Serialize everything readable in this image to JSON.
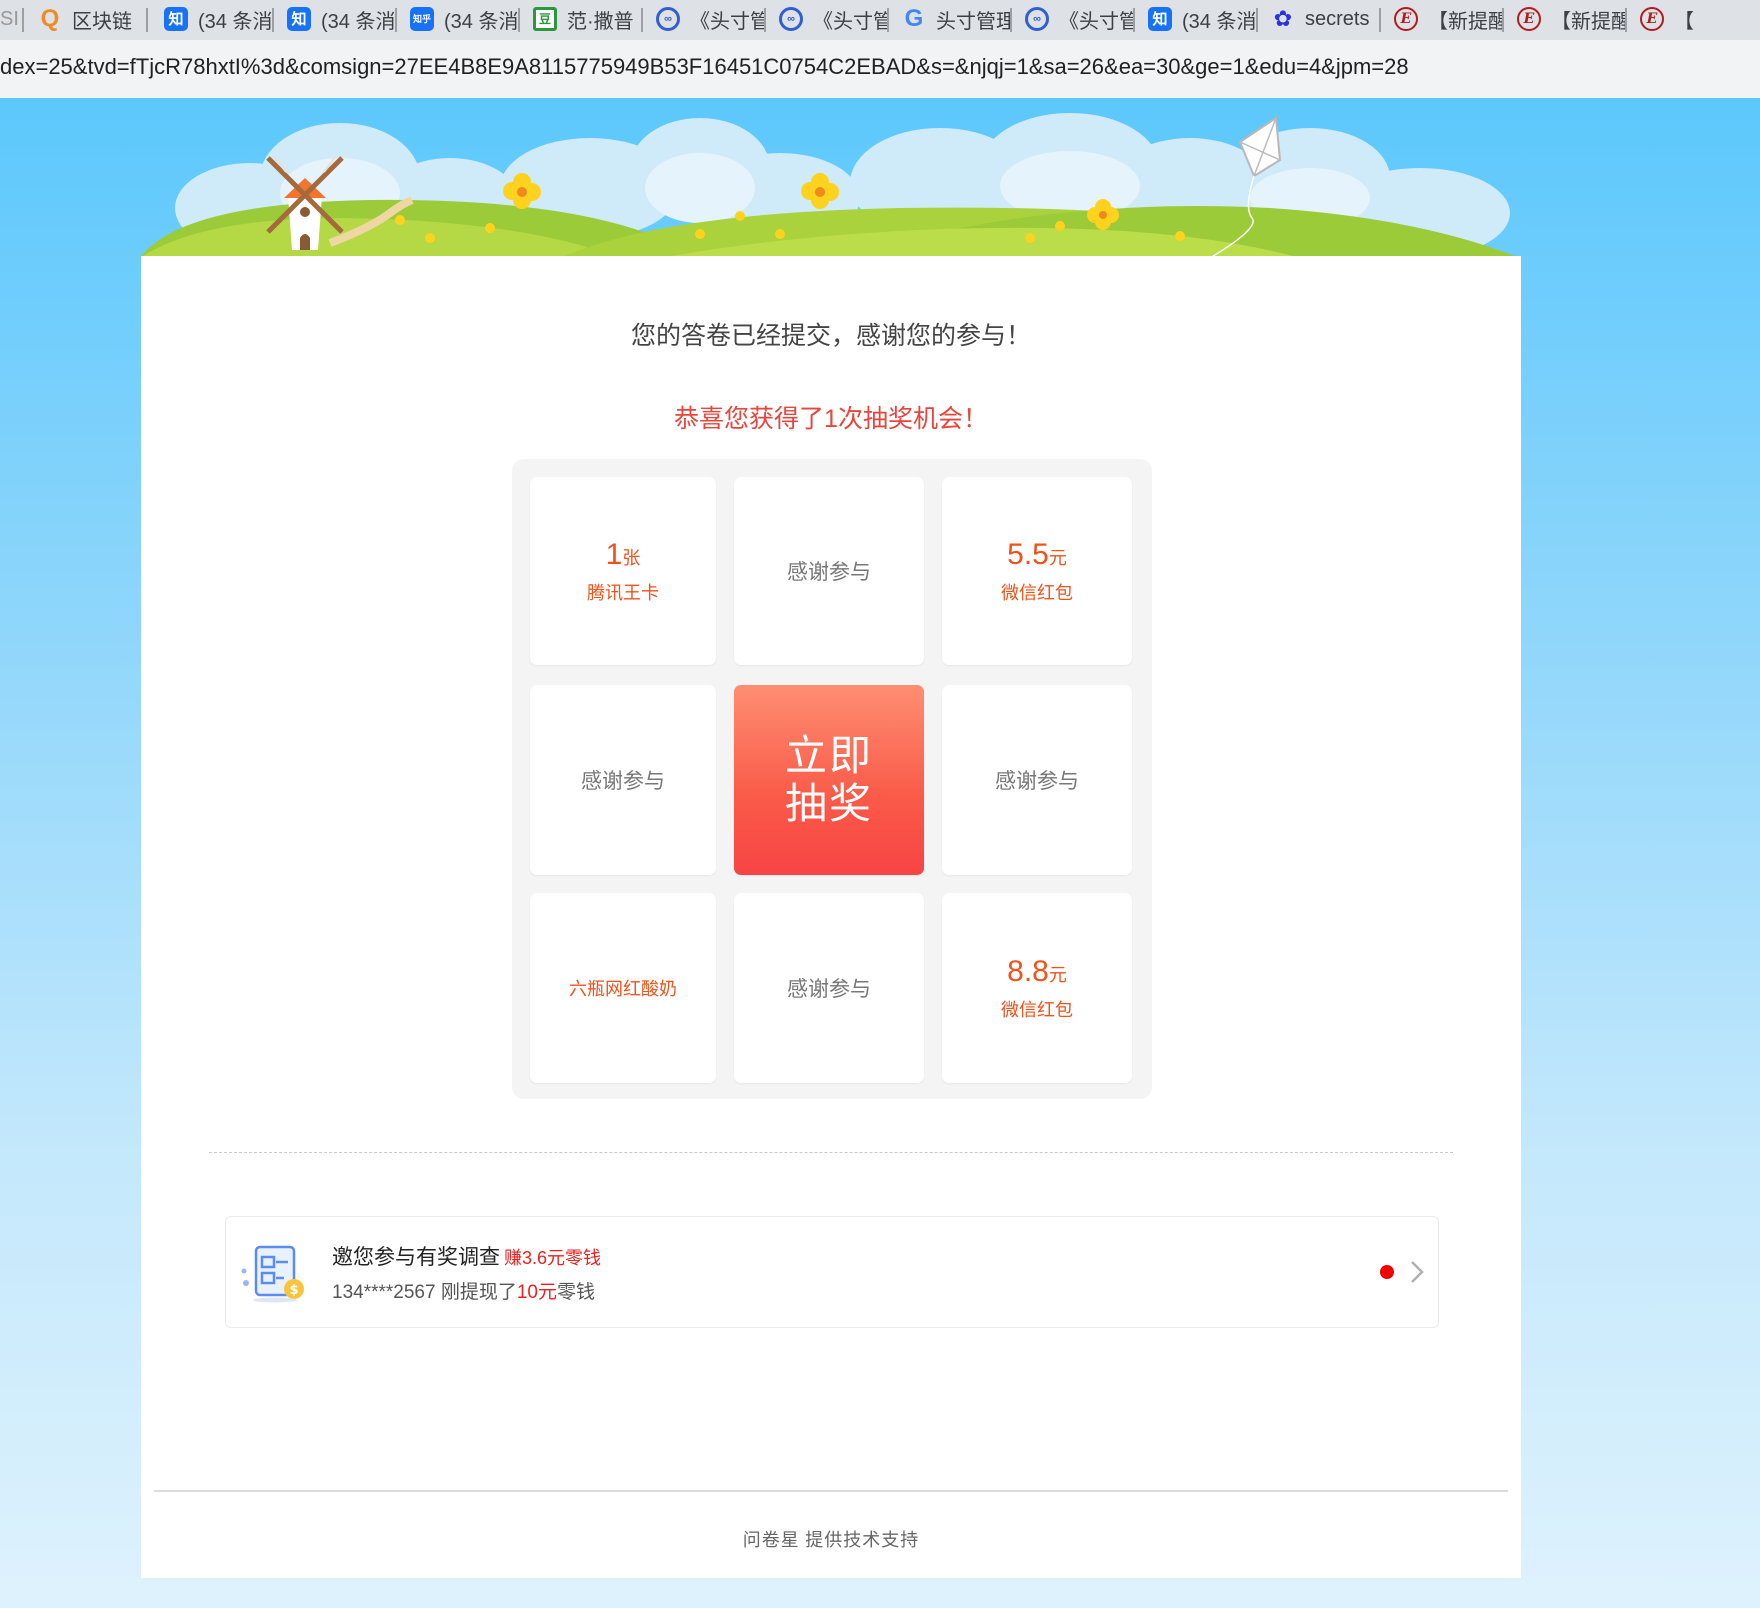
{
  "browser": {
    "tabs": [
      {
        "icon": "generic-icon",
        "title": "SI"
      },
      {
        "icon": "qq-browser-icon",
        "title": "区块链"
      },
      {
        "icon": "zhihu-icon",
        "title": "(34 条消"
      },
      {
        "icon": "zhihu-icon",
        "title": "(34 条消"
      },
      {
        "icon": "zhihu-app-icon",
        "title": "(34 条消"
      },
      {
        "icon": "douban-icon",
        "title": "范·撒普"
      },
      {
        "icon": "toutiao-icon",
        "title": "《头寸管"
      },
      {
        "icon": "toutiao-icon",
        "title": "《头寸管"
      },
      {
        "icon": "google-icon",
        "title": "头寸管理"
      },
      {
        "icon": "toutiao-icon",
        "title": "《头寸管"
      },
      {
        "icon": "zhihu-icon",
        "title": "(34 条消"
      },
      {
        "icon": "baidu-paw-icon",
        "title": "secrets"
      },
      {
        "icon": "e-icon",
        "title": "【新提醒"
      },
      {
        "icon": "e-icon",
        "title": "【新提醒"
      },
      {
        "icon": "e-icon",
        "title": "【"
      }
    ],
    "url": "dex=25&tvd=fTjcR78hxtI%3d&comsign=27EE4B8E9A8115775949B53F16451C0754C2EBAD&s=&njqj=1&sa=26&ea=30&ge=1&edu=4&jpm=28"
  },
  "result": {
    "thanks": "您的答卷已经提交，感谢您的参与！",
    "chance": "恭喜您获得了1次抽奖机会！"
  },
  "lottery": {
    "prize1": {
      "amount": "1",
      "unit": "张",
      "desc": "腾讯王卡"
    },
    "prize2": {
      "text": "感谢参与"
    },
    "prize3": {
      "amount": "5.5",
      "unit": "元",
      "desc": "微信红包"
    },
    "prize4": {
      "text": "感谢参与"
    },
    "draw_line1": "立即",
    "draw_line2": "抽奖",
    "prize6": {
      "text": "感谢参与"
    },
    "prize7": {
      "text": "六瓶网红酸奶"
    },
    "prize8": {
      "text": "感谢参与"
    },
    "prize9": {
      "amount": "8.8",
      "unit": "元",
      "desc": "微信红包"
    }
  },
  "invite": {
    "title": "邀您参与有奖调查",
    "earn": "赚3.6元零钱",
    "sub_prefix": "134****2567 刚提现了",
    "sub_amount": "10元",
    "sub_suffix": "零钱"
  },
  "footer": "问卷星 提供技术支持",
  "colors": {
    "accent_red": "#e8453c",
    "prize_orange": "#f0521c",
    "draw_button_top": "#fe8e72",
    "draw_button_bottom": "#f74444",
    "sky": "#5cc8fc"
  }
}
